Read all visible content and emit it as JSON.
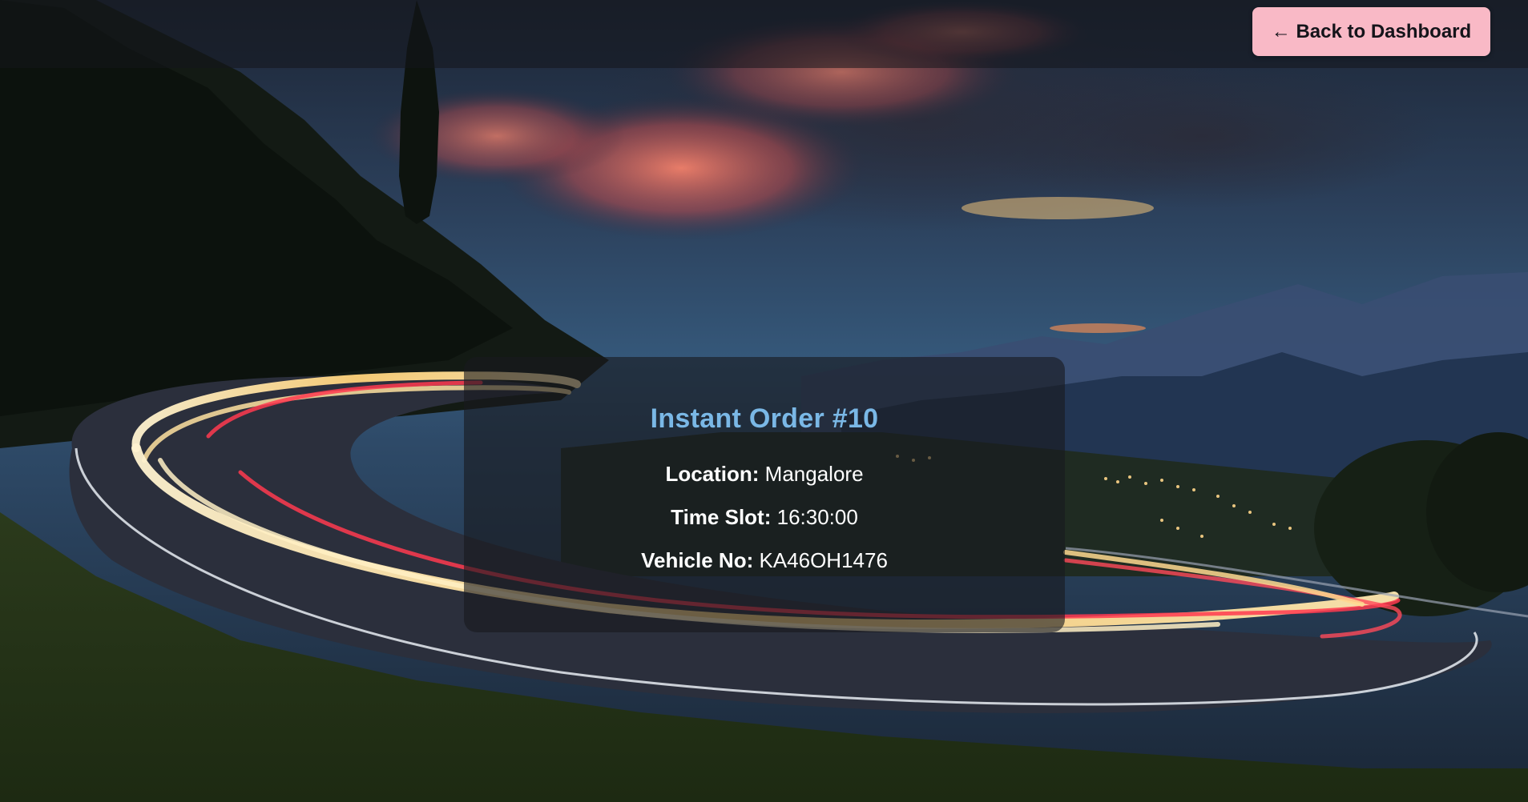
{
  "header": {
    "back_button_label": "← Back to Dashboard"
  },
  "order": {
    "title": "Instant Order #10",
    "location_label": "Location:",
    "location_value": "Mangalore",
    "time_slot_label": "Time Slot:",
    "time_slot_value": "16:30:00",
    "vehicle_label": "Vehicle No:",
    "vehicle_value": "KA46OH1476"
  },
  "colors": {
    "accent_title": "#7ab8e6",
    "button_bg": "#f9b9c6",
    "card_bg": "rgba(24,26,30,0.62)"
  }
}
